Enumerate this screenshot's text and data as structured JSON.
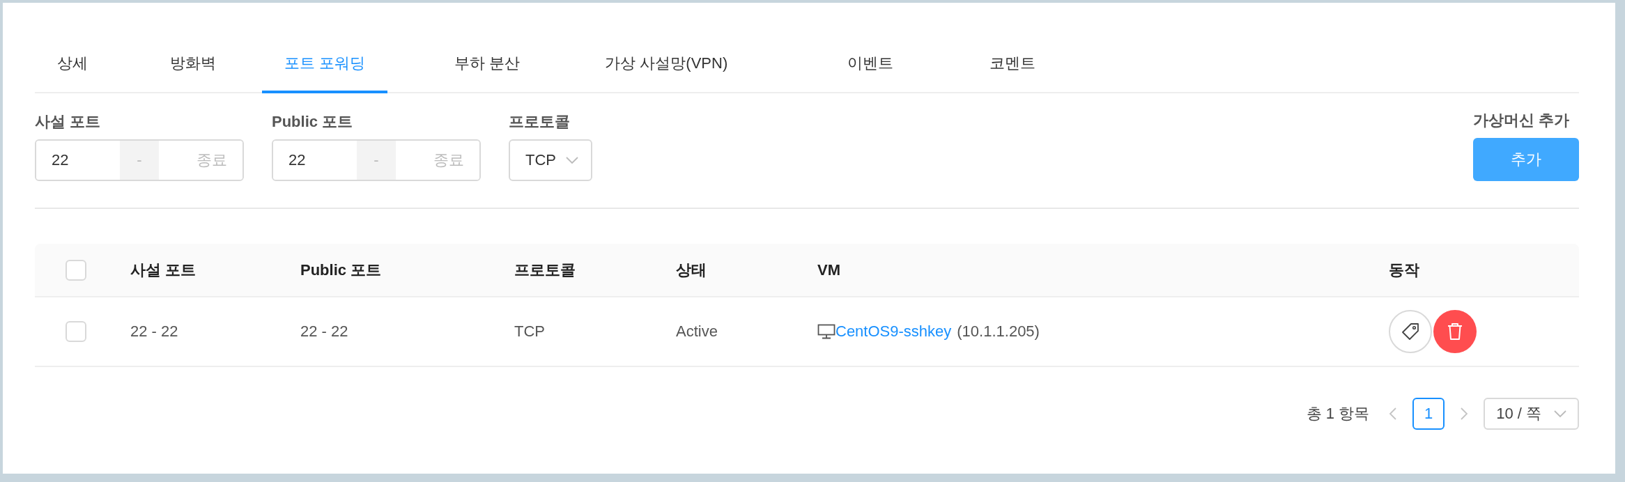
{
  "tabs": [
    {
      "label": "상세",
      "selected": false
    },
    {
      "label": "방화벽",
      "selected": false
    },
    {
      "label": "포트 포워딩",
      "selected": true
    },
    {
      "label": "부하 분산",
      "selected": false
    },
    {
      "label": "가상 사설망(VPN)",
      "selected": false
    },
    {
      "label": "이벤트",
      "selected": false
    },
    {
      "label": "코멘트",
      "selected": false
    }
  ],
  "form": {
    "fields": [
      {
        "kind": "range",
        "label": "사설 포트",
        "value": "22",
        "separator": "-",
        "placeholder": "종료"
      },
      {
        "kind": "range",
        "label": "Public 포트",
        "value": "22",
        "separator": "-",
        "placeholder": "종료"
      },
      {
        "kind": "select",
        "label": "프로토콜",
        "value": "TCP"
      }
    ],
    "add": {
      "label": "가상머신 추가",
      "button": "추가"
    }
  },
  "table": {
    "header_checkbox": {
      "checked": false
    },
    "columns": [
      "사설 포트",
      "Public 포트",
      "프로토콜",
      "상태",
      "VM",
      "동작"
    ],
    "rows": [
      {
        "checked": false,
        "private_port": "22 - 22",
        "public_port": "22 - 22",
        "protocol": "TCP",
        "status": "Active",
        "vm_name": "CentOS9-sshkey",
        "vm_ip": "(10.1.1.205)"
      }
    ]
  },
  "pagination": {
    "total": "총 1 항목",
    "prev_disabled": true,
    "pages": [
      {
        "label": "1",
        "selected": true
      }
    ],
    "next_disabled": true,
    "page_size": "10 / 쪽"
  }
}
